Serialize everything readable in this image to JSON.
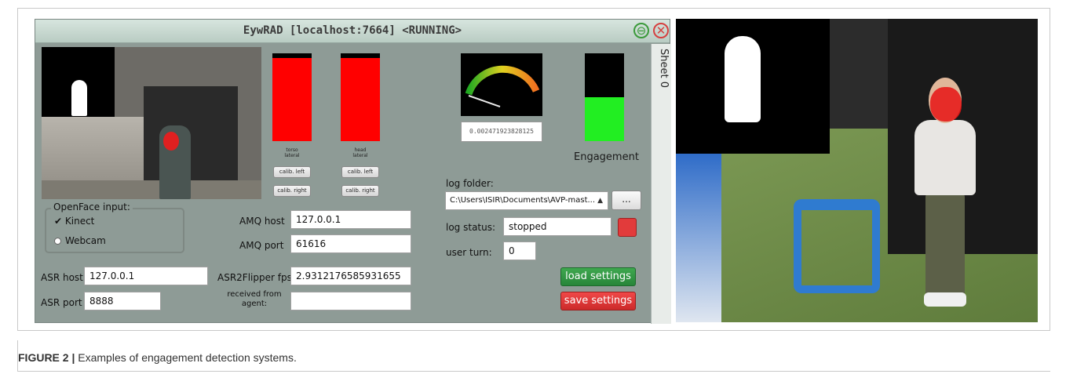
{
  "window": {
    "title": "EywRAD [localhost:7664] <RUNNING>",
    "sheet_tab": "Sheet 0"
  },
  "sensors": {
    "torso_label": "torso\nlateral",
    "head_label": "head\nlateral",
    "calib_left": "calib. left",
    "calib_right": "calib. right",
    "torso_level": 0.95,
    "head_level": 0.95
  },
  "meter": {
    "value_text": "0.002471923828125"
  },
  "engagement": {
    "label": "Engagement",
    "level": 0.5
  },
  "openface": {
    "group_title": "OpenFace input:",
    "options": [
      "Kinect",
      "Webcam"
    ],
    "selected": "Kinect"
  },
  "amq": {
    "host_label": "AMQ host",
    "host_value": "127.0.0.1",
    "port_label": "AMQ port",
    "port_value": "61616"
  },
  "asr": {
    "host_label": "ASR host",
    "host_value": "127.0.0.1",
    "port_label": "ASR port",
    "port_value": "8888",
    "flipper_label": "ASR2Flipper fps:",
    "flipper_value": "2.9312176585931655",
    "received_label": "received from\nagent:",
    "received_value": ""
  },
  "log": {
    "folder_label": "log folder:",
    "folder_value": "C:\\Users\\ISIR\\Documents\\AVP-mast...",
    "browse_label": "...",
    "status_label": "log status:",
    "status_value": "stopped",
    "user_turn_label": "user turn:",
    "user_turn_value": "0"
  },
  "buttons": {
    "load": "load settings",
    "save": "save settings"
  },
  "caption": {
    "figure": "FIGURE 2 |",
    "text": " Examples of engagement detection systems."
  },
  "colors": {
    "panel": "#8e9b96",
    "gauge_red": "#ff0000",
    "engagement_green": "#22ee22",
    "load_green": "#2f9a44",
    "save_red": "#e03a3a"
  }
}
